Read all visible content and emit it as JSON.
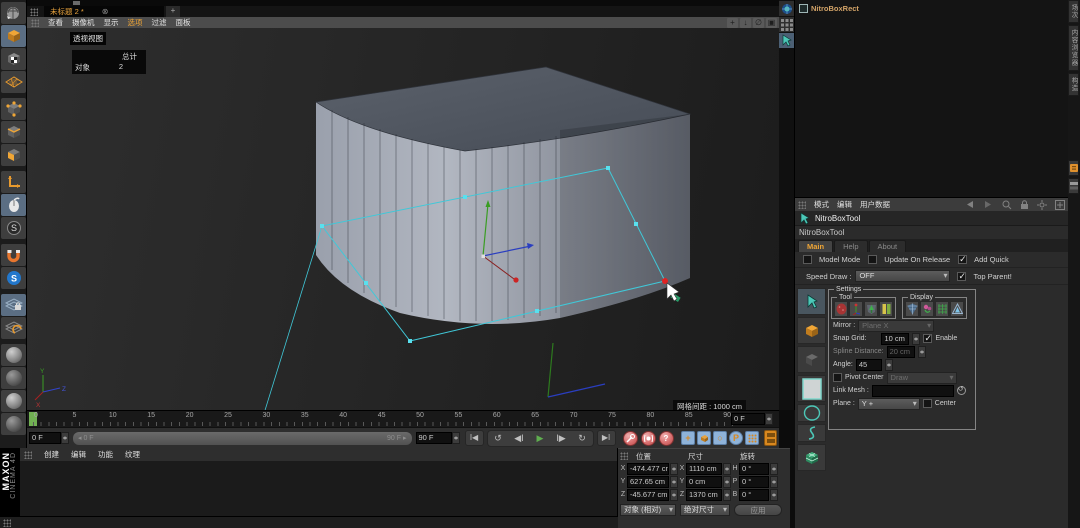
{
  "colors": {
    "accent_orange": "#E8A33D",
    "cage_cyan": "#40C8D8",
    "playhead_green": "#71B153",
    "record_red": "#D97070",
    "key_blue": "#8FB3D9",
    "object_name_tan": "#D2A368"
  },
  "window": {
    "tab_title": "未标题 2 *",
    "tab_close": "⊗",
    "tab_add": "+"
  },
  "viewport": {
    "menu": [
      "查看",
      "摄像机",
      "显示",
      "选项",
      "过滤",
      "面板"
    ],
    "hud": {
      "view": "透视视图",
      "total": "总计",
      "objects": "对象",
      "count": "2"
    },
    "grid_spacing": "网格间距 : 1000 cm",
    "axis": {
      "x": "X",
      "y": "Y",
      "z": "Z"
    }
  },
  "timeline": {
    "ticks": [
      "0",
      "5",
      "10",
      "15",
      "20",
      "25",
      "30",
      "35",
      "40",
      "45",
      "50",
      "55",
      "60",
      "65",
      "70",
      "75",
      "80",
      "85",
      "90"
    ],
    "end_field": "0 F"
  },
  "transport": {
    "current_frame": "0 F",
    "range_start": "◂ 0 F",
    "range_end": "90 F ▸",
    "end_frame": "90 F",
    "goto_start": "Ι◀",
    "prev_key": "↺",
    "prev_frame": "◀Ι",
    "play": "▶",
    "next_frame": "Ι▶",
    "next_key": "↻",
    "goto_end": "▶Ι",
    "record_question": "?",
    "key_plus": "+",
    "key_rot": "○",
    "key_param": "P"
  },
  "materials": {
    "menu": [
      "创建",
      "编辑",
      "功能",
      "纹理"
    ],
    "brand_top": "MAXON",
    "brand_bottom": "CINEMA 4D"
  },
  "coordinates": {
    "headers": [
      "位置",
      "尺寸",
      "旋转"
    ],
    "rows": [
      {
        "axis": "X",
        "pos": "-474.477 cm",
        "saxis": "X",
        "size": "1110 cm",
        "raxis": "H",
        "rot": "0 °"
      },
      {
        "axis": "Y",
        "pos": "627.65 cm",
        "saxis": "Y",
        "size": "0 cm",
        "raxis": "P",
        "rot": "0 °"
      },
      {
        "axis": "Z",
        "pos": "-45.677 cm",
        "saxis": "Z",
        "size": "1370 cm",
        "raxis": "B",
        "rot": "0 °"
      }
    ],
    "mode_dropdown": "对象 (相对)",
    "size_dropdown": "绝对尺寸",
    "apply_button": "应用"
  },
  "object_manager": {
    "item_name": "NitroBoxRect",
    "enabled_check": "✓"
  },
  "side_tabs": {
    "takes": "场次",
    "content_browser": "内容浏览器",
    "structure": "构造"
  },
  "attributes": {
    "menu": [
      "模式",
      "编辑",
      "用户数据"
    ],
    "icon_title": "NitroBoxTool",
    "tool_name": "NitroBoxTool",
    "tabs": [
      "Main",
      "Help",
      "About"
    ],
    "model_mode": "Model Mode",
    "update_on_release": "Update On Release",
    "add_quick": "Add Quick",
    "speed_draw_label": "Speed Draw :",
    "speed_draw_value": "OFF",
    "top_parent": "Top Parent!",
    "settings": {
      "legend": "Settings",
      "tool_legend": "Tool",
      "display_legend": "Display",
      "mirror_label": "Mirror :",
      "mirror_value": "Plane X",
      "snap_label": "Snap Grid:",
      "snap_value": "10 cm",
      "enable_label": "Enable",
      "spline_label": "Spline Distance:",
      "spline_value": "20 cm",
      "angle_label": "Angle:",
      "angle_value": "45",
      "pivot_label": "Pivot Center",
      "pivot_value": "Draw",
      "link_label": "Link Mesh :",
      "plane_label": "Plane :",
      "plane_value": "Y +",
      "center_label": "Center"
    }
  }
}
